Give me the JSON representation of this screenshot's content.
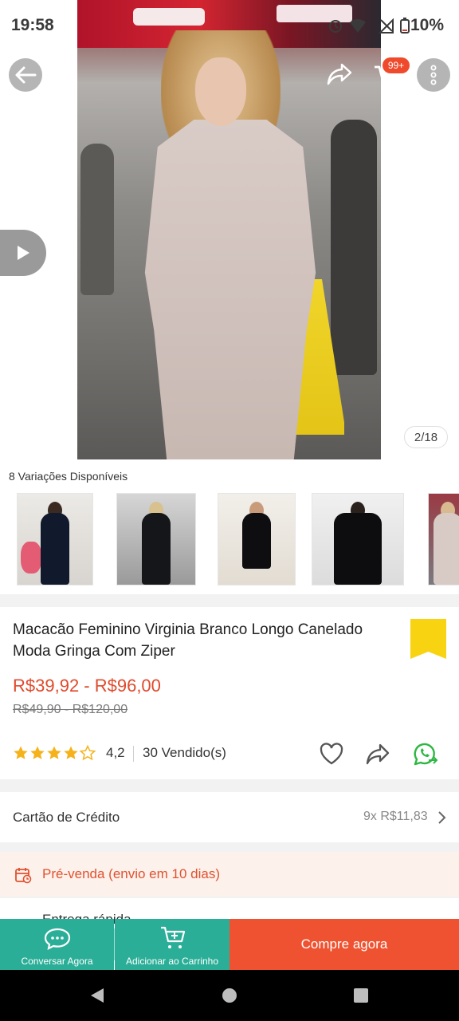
{
  "status_bar": {
    "time": "19:58",
    "battery": "10%"
  },
  "header": {
    "cart_badge": "99+"
  },
  "gallery": {
    "page_indicator": "2/18"
  },
  "variations": {
    "label": "8 Variações Disponíveis",
    "count_visible": 5
  },
  "product": {
    "title": "Macacão Feminino Virginia Branco Longo Canelado Moda Gringa Com Ziper",
    "price_range": "R$39,92 - R$96,00",
    "old_price_range": "R$49,90 - R$120,00",
    "rating": "4,2",
    "rating_value": 4.2,
    "sold": "30 Vendido(s)"
  },
  "payment": {
    "label": "Cartão de Crédito",
    "installments": "9x R$11,83"
  },
  "presale": {
    "text": "Pré-venda (envio em 10 dias)"
  },
  "cut_row": {
    "text": "Entrega rápida"
  },
  "bottom_bar": {
    "chat_label": "Conversar Agora",
    "cart_label": "Adicionar ao Carrinho",
    "buy_label": "Compre agora"
  },
  "colors": {
    "accent": "#ef5230",
    "teal": "#2bae97",
    "price": "#e04a2c",
    "star": "#f6b21a",
    "bookmark": "#f7d312"
  }
}
